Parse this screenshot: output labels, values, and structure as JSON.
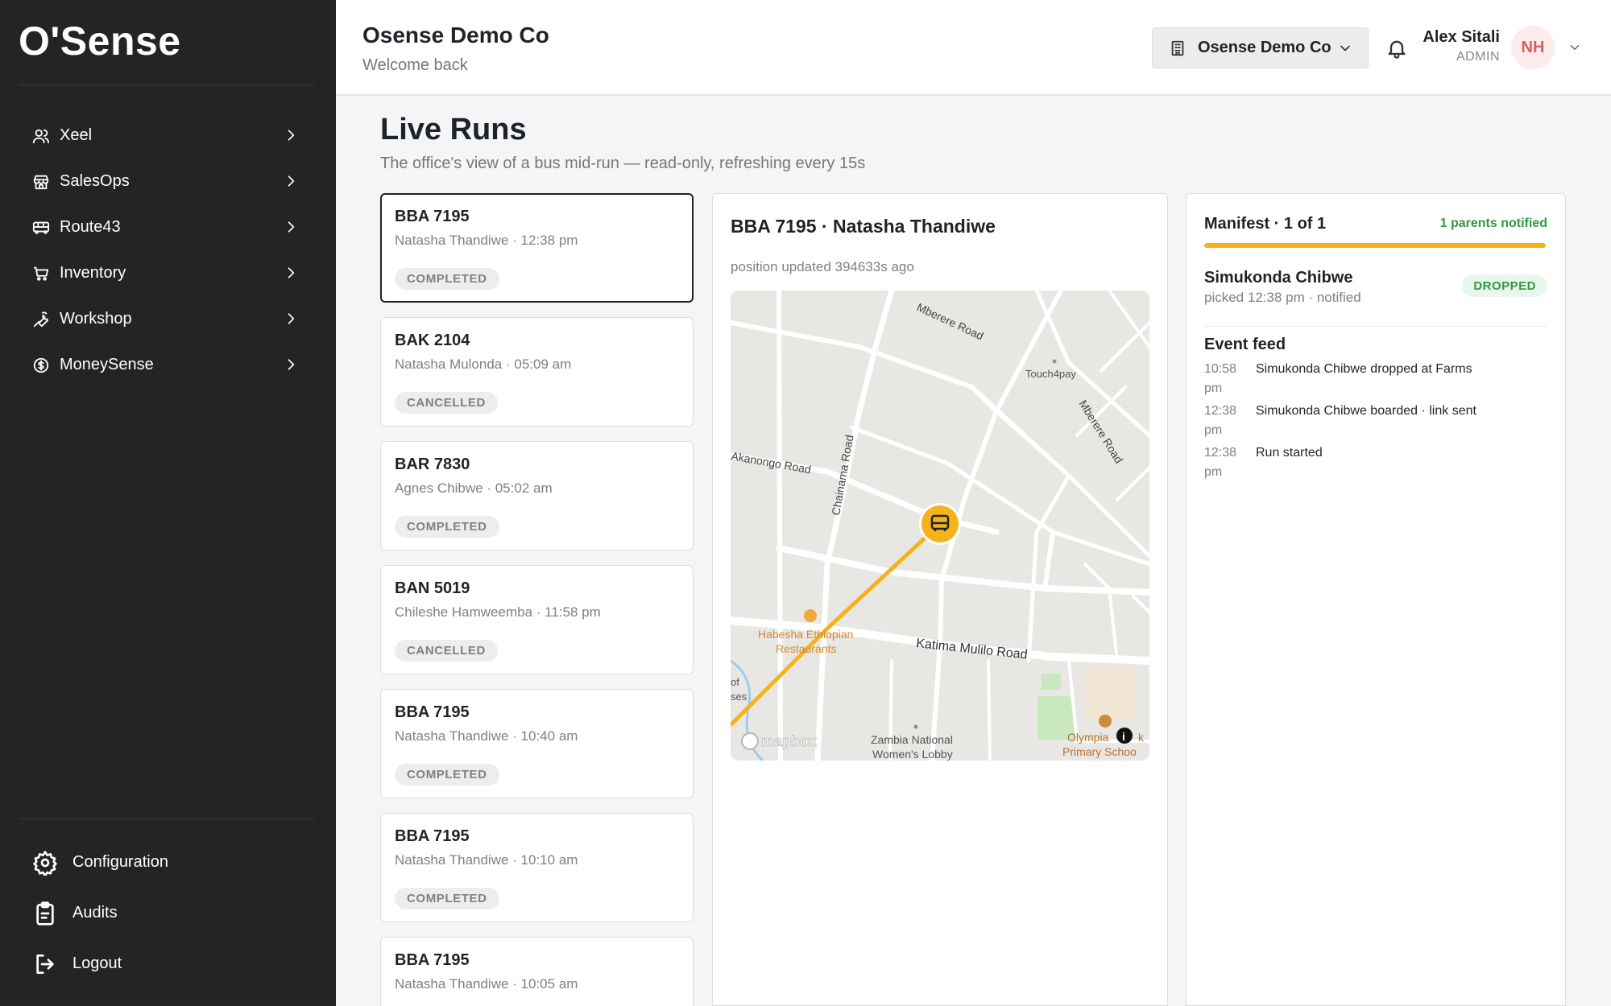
{
  "brand": "O'Sense",
  "sidebar": {
    "items": [
      {
        "label": "Xeel",
        "icon": "users-icon"
      },
      {
        "label": "SalesOps",
        "icon": "store-icon"
      },
      {
        "label": "Route43",
        "icon": "bus-icon"
      },
      {
        "label": "Inventory",
        "icon": "cart-icon"
      },
      {
        "label": "Workshop",
        "icon": "wrench-icon"
      },
      {
        "label": "MoneySense",
        "icon": "dollar-circle-icon"
      }
    ],
    "bottom": [
      {
        "label": "Configuration",
        "icon": "gear-icon"
      },
      {
        "label": "Audits",
        "icon": "clipboard-icon"
      },
      {
        "label": "Logout",
        "icon": "logout-icon"
      }
    ]
  },
  "header": {
    "title": "Osense Demo Co",
    "subtitle": "Welcome back",
    "org_select": "Osense Demo Co",
    "user_name": "Alex Sitali",
    "user_role": "ADMIN",
    "avatar_initials": "NH"
  },
  "page": {
    "title": "Live Runs",
    "subtitle": "The office's view of a bus mid-run — read-only, refreshing every 15s"
  },
  "runs": [
    {
      "plate": "BBA 7195",
      "meta": "Natasha Thandiwe · 12:38 pm",
      "status": "COMPLETED"
    },
    {
      "plate": "BAK 2104",
      "meta": "Natasha Mulonda · 05:09 am",
      "status": "CANCELLED"
    },
    {
      "plate": "BAR 7830",
      "meta": "Agnes Chibwe · 05:02 am",
      "status": "COMPLETED"
    },
    {
      "plate": "BAN 5019",
      "meta": "Chileshe Hamweemba · 11:58 pm",
      "status": "CANCELLED"
    },
    {
      "plate": "BBA 7195",
      "meta": "Natasha Thandiwe · 10:40 am",
      "status": "COMPLETED"
    },
    {
      "plate": "BBA 7195",
      "meta": "Natasha Thandiwe · 10:10 am",
      "status": "COMPLETED"
    },
    {
      "plate": "BBA 7195",
      "meta": "Natasha Thandiwe · 10:05 am",
      "status": ""
    }
  ],
  "map_panel": {
    "title": "BBA 7195 · Natasha Thandiwe",
    "updated": "position updated 394633s ago",
    "labels": {
      "mberere_top": "Mberere Road",
      "touch4pay": "Touch4pay",
      "mberere_right": "Mberere Road",
      "akanongo": "Akanongo Road",
      "chainama": "Chainama Road",
      "habesha1": "Habesha Ethiopian",
      "habesha2": "Restaurants",
      "katima": "Katima Mulilo Road",
      "left_of": "of",
      "left_ses": "ses",
      "zambia1": "Zambia National",
      "zambia2": "Women's Lobby",
      "olympia": "Olympia",
      "olympia_k": "k",
      "primary": "Primary Schoo",
      "mapbox": "mapbox"
    }
  },
  "manifest": {
    "title": "Manifest · 1 of 1",
    "notified": "1 parents notified",
    "progress": 1.0,
    "passenger": {
      "name": "Simukonda Chibwe",
      "meta": "picked 12:38 pm · notified",
      "status": "DROPPED"
    },
    "feed_title": "Event feed",
    "events": [
      {
        "time": "10:58 pm",
        "text": "Simukonda Chibwe dropped at Farms"
      },
      {
        "time": "12:38 pm",
        "text": "Simukonda Chibwe boarded · link sent"
      },
      {
        "time": "12:38 pm",
        "text": "Run started"
      }
    ]
  },
  "colors": {
    "accent": "#f5b31b",
    "sidebar": "#242424",
    "success": "#2e9a3e",
    "avatar": "#e15b5b"
  }
}
